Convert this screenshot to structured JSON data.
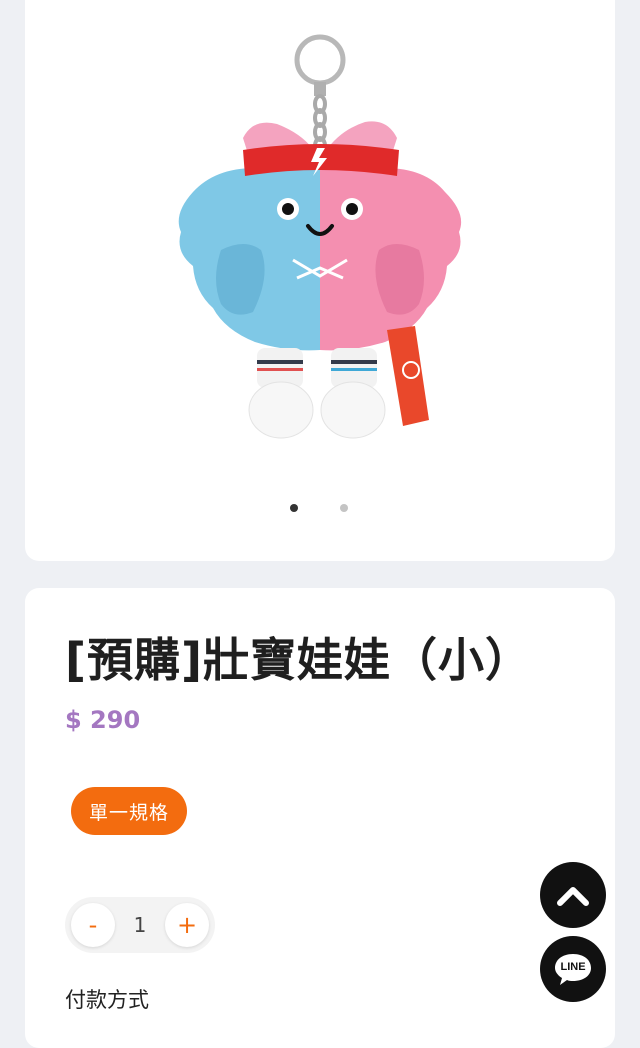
{
  "product": {
    "title": "[預購]壯寶娃娃（小）",
    "price": "$ 290",
    "image_alt": "壯寶娃娃 plush keychain",
    "image_pagination": {
      "count": 2,
      "active_index": 0
    }
  },
  "variant": {
    "selected_label": "單一規格"
  },
  "quantity": {
    "minus_label": "-",
    "value": "1",
    "plus_label": "+"
  },
  "payment": {
    "section_label": "付款方式"
  },
  "floating": {
    "scroll_top_icon": "chevron-up-icon",
    "line_label": "LINE"
  },
  "colors": {
    "accent_orange": "#f36c0f",
    "price_purple": "#a477c1",
    "background": "#eef0f4",
    "fab_black": "#111111"
  }
}
